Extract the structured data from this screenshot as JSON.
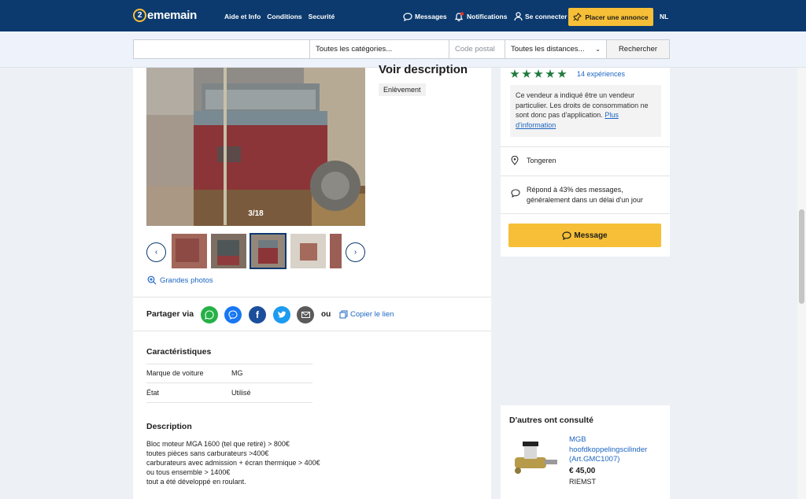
{
  "header": {
    "logo_mark": "2",
    "logo_text": "ememain",
    "nav": [
      "Aide et Info",
      "Conditions",
      "Securité"
    ],
    "messages": "Messages",
    "notifications": "Notifications",
    "login": "Se connecter",
    "post_ad": "Placer une annonce",
    "lang": "NL",
    "colors": {
      "bar": "#0c3a6e",
      "accent": "#f6bf37"
    }
  },
  "search": {
    "query_placeholder": "",
    "category": "Toutes les catégories...",
    "postal_placeholder": "Code postal",
    "distance": "Toutes les distances...",
    "button": "Rechercher"
  },
  "listing": {
    "heading_partial": "Voir description",
    "tag": "Enlèvement",
    "photo_counter": "3/18",
    "large_photos": "Grandes photos",
    "share_label": "Partager via",
    "share_icons": [
      "whatsapp-icon",
      "messenger-icon",
      "facebook-icon",
      "twitter-icon",
      "email-icon"
    ],
    "share_or": "ou",
    "copy_link": "Copier le lien",
    "characteristics_title": "Caractéristiques",
    "characteristics": [
      {
        "label": "Marque de voiture",
        "value": "MG"
      },
      {
        "label": "État",
        "value": "Utilisé"
      }
    ],
    "description_title": "Description",
    "description_lines": [
      "Bloc moteur MGA 1600 (tel que retiré) > 800€",
      "toutes pièces sans carburateurs >400€",
      "carburateurs avec admission + écran thermique > 400€",
      "ou tous ensemble > 1400€",
      "tout a été développé en roulant."
    ]
  },
  "seller": {
    "rating_stars": 5,
    "experiences": "14 expériences",
    "notice_text": "Ce vendeur a indiqué être un vendeur particulier. Les droits de consommation ne sont donc pas d'application.",
    "notice_link": "Plus d'information",
    "location": "Tongeren",
    "response": "Répond à 43% des messages, généralement dans un délai d'un jour",
    "message_button": "Message"
  },
  "others": {
    "title": "D'autres ont consulté",
    "item": {
      "title": "MGB hoofdkoppelingscilinder (Art.GMC1007)",
      "price": "€ 45,00",
      "location": "RIEMST"
    }
  }
}
